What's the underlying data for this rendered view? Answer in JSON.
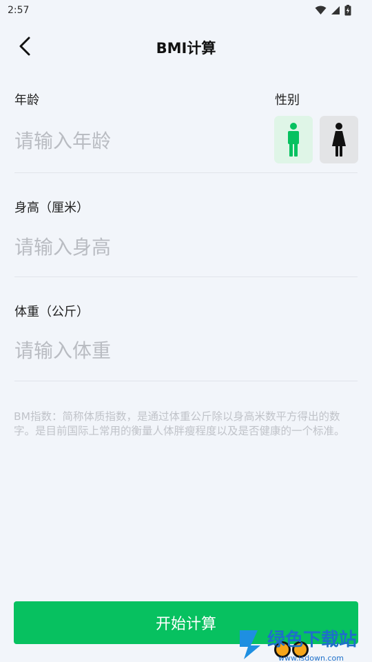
{
  "status_bar": {
    "time": "2:57",
    "icons": [
      "wifi-icon",
      "signal-icon",
      "battery-charging-icon"
    ]
  },
  "header": {
    "title": "BMI计算",
    "back_icon": "chevron-left-icon"
  },
  "form": {
    "age": {
      "label": "年龄",
      "placeholder": "请输入年龄",
      "value": ""
    },
    "gender": {
      "label": "性别",
      "options": [
        "male",
        "female"
      ],
      "selected": "male"
    },
    "height": {
      "label": "身高（厘米）",
      "placeholder": "请输入身高",
      "value": ""
    },
    "weight": {
      "label": "体重（公斤）",
      "placeholder": "请输入体重",
      "value": ""
    }
  },
  "description": "BM指数：简称体质指数，是通过体重公斤除以身高米数平方得出的数字。是目前国际上常用的衡量人体胖瘦程度以及是否健康的一个标准。",
  "start_button": {
    "label": "开始计算"
  },
  "watermark": {
    "text_main": "绿色下载站",
    "text_domain": "www.lsdown.com"
  },
  "colors": {
    "accent": "#07c160",
    "background": "#f2f5fa",
    "male_bg": "#dff5e7",
    "female_bg": "#e3e4e6"
  }
}
